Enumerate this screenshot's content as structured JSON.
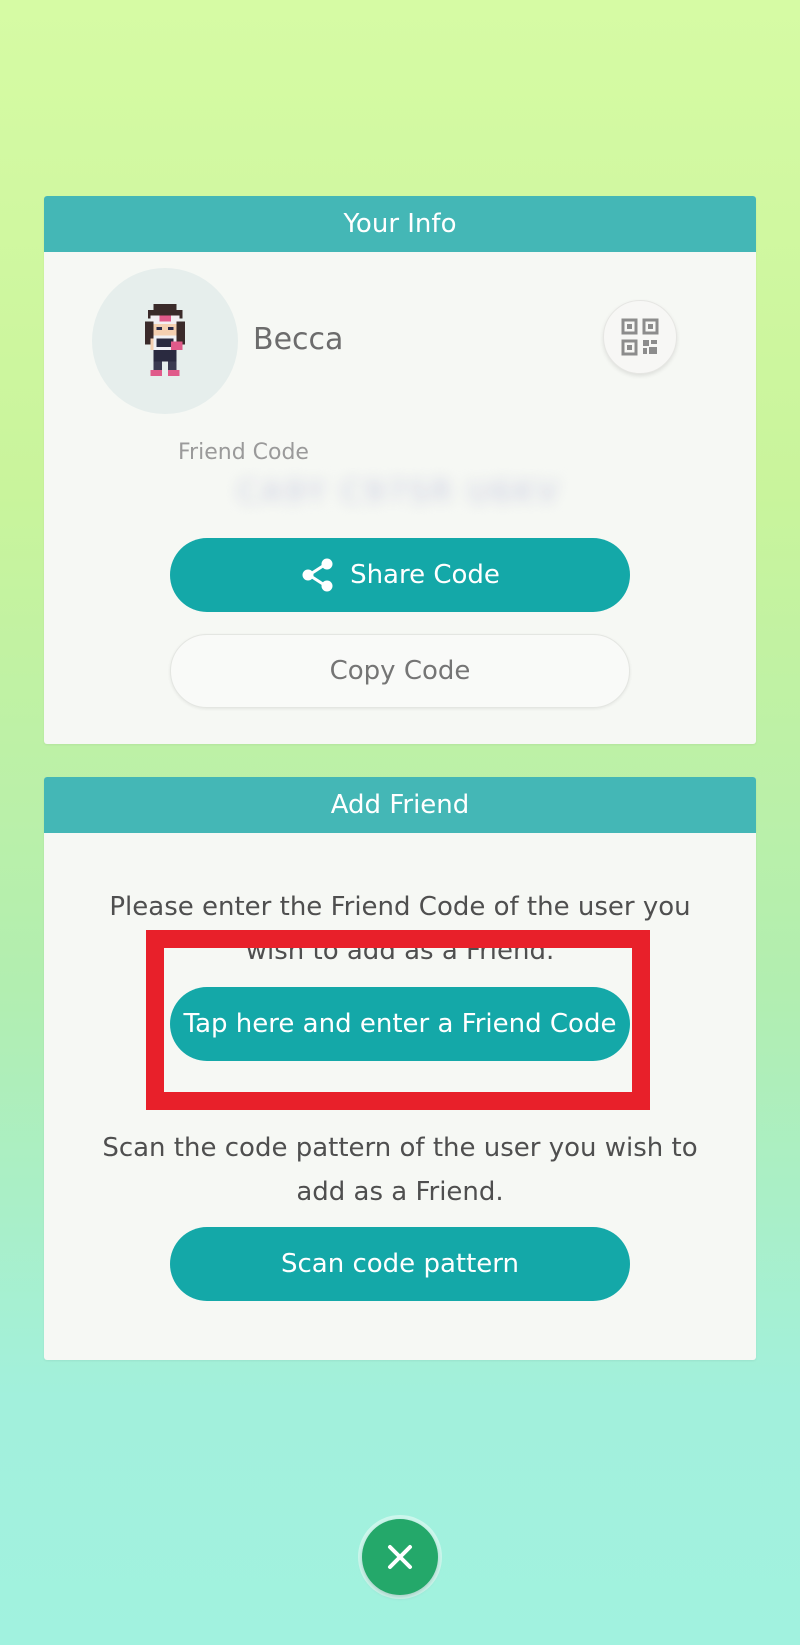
{
  "colors": {
    "header": "#44b7b6",
    "primary_button": "#14a8a8",
    "close_button": "#24a86a",
    "highlight_box": "#e8202a"
  },
  "your_info": {
    "title": "Your Info",
    "avatar_icon": "trainer-sprite-icon",
    "username": "Becca",
    "qr_icon": "qr-code-icon",
    "friend_code_label": "Friend Code",
    "friend_code_value": "CA9Y C97SR U6KV",
    "share_icon": "share-icon",
    "share_label": "Share Code",
    "copy_label": "Copy Code"
  },
  "add_friend": {
    "title": "Add Friend",
    "enter_instruction": "Please enter the Friend Code of the user you wish to add as a Friend.",
    "enter_button_label": "Tap here and enter a Friend Code",
    "scan_instruction": "Scan the code pattern of the user you wish to add as a Friend.",
    "scan_button_label": "Scan code pattern"
  },
  "close": {
    "icon": "close-icon"
  }
}
